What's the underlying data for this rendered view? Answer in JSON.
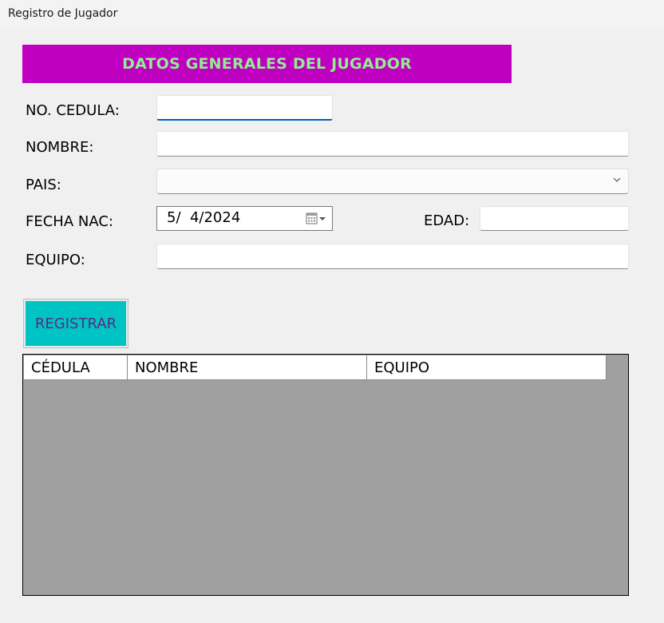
{
  "window": {
    "title": "Registro de Jugador"
  },
  "banner": {
    "text": "DATOS GENERALES DEL JUGADOR",
    "background": "#c000c0",
    "text_color": "#90ee90"
  },
  "form": {
    "cedula": {
      "label": "NO. CEDULA:",
      "value": ""
    },
    "nombre": {
      "label": "NOMBRE:",
      "value": ""
    },
    "pais": {
      "label": "PAIS:",
      "selected": ""
    },
    "fecha_nac": {
      "label": "FECHA NAC:",
      "value": "5/  4/2024"
    },
    "edad": {
      "label": "EDAD:",
      "value": ""
    },
    "equipo": {
      "label": "EQUIPO:",
      "value": ""
    }
  },
  "buttons": {
    "register_label": "REGISTRAR",
    "register_color": "#00c4c4"
  },
  "grid": {
    "columns": [
      "CÉDULA",
      "NOMBRE",
      "EQUIPO"
    ],
    "rows": [],
    "background": "#a0a0a0"
  },
  "icons": {
    "dropdown": "chevron-down-icon",
    "calendar": "calendar-icon"
  }
}
